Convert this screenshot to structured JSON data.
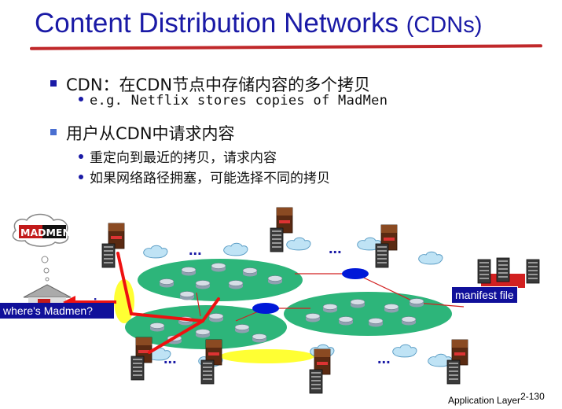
{
  "title": {
    "main": "Content Distribution Networks",
    "abbr": "(CDNs)"
  },
  "bullets": [
    {
      "text": "CDN：在CDN节点中存储内容的多个拷贝",
      "subs": [
        "e.g. Netflix stores copies of MadMen"
      ]
    },
    {
      "text": "用户从CDN中请求内容",
      "subs": [
        "重定向到最近的拷贝，请求内容",
        "如果网络路径拥塞，可能选择不同的拷贝"
      ]
    }
  ],
  "diagram": {
    "logo_text": "MADMEN",
    "cluster_ellipsis": "...",
    "where_label": "where's Madmen?",
    "manifest_label": "manifest file",
    "colors": {
      "network": "#2db57a",
      "link": "#d22020",
      "request_path": "#ee1111",
      "node": "#0018d8",
      "highlight": "#ffff33"
    }
  },
  "footer": {
    "text": "Application Layer",
    "page": "2-130"
  }
}
